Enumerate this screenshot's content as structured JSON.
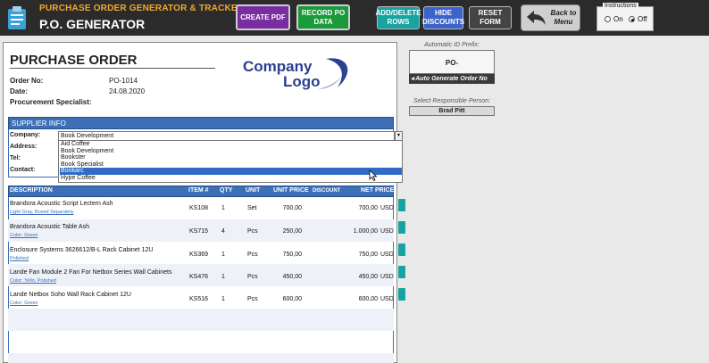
{
  "app": {
    "subtitle": "PURCHASE ORDER GENERATOR & TRACKER",
    "title": "P.O. GENERATOR"
  },
  "toolbar": {
    "create_pdf": "CREATE PDF",
    "record_po": "RECORD PO DATA",
    "add_delete": "ADD/DELETE ROWS",
    "hide_discounts": "HIDE DISCOUNTS",
    "reset_form": "RESET FORM",
    "back_to_menu": "Back to Menu"
  },
  "instructions": {
    "label": "Instructions",
    "on": "On",
    "off": "Off",
    "selected": "Off"
  },
  "po": {
    "title": "PURCHASE ORDER",
    "order_no_label": "Order No:",
    "order_no": "PO-1014",
    "date_label": "Date:",
    "date": "24.08.2020",
    "specialist_label": "Procurement Specialist:"
  },
  "logo": {
    "line1": "Company",
    "line2": "Logo"
  },
  "supplier": {
    "header": "SUPPLIER INFO",
    "company_label": "Company:",
    "company_value": "Book Development",
    "address_label": "Address:",
    "tel_label": "Tel:",
    "contact_label": "Contact:",
    "options": [
      "Aid Coffee",
      "Book Development",
      "Bookster",
      "Book Specialist",
      "Bookarc",
      "Hype Coffee"
    ],
    "selected_option": "Bookarc"
  },
  "table": {
    "headers": {
      "description": "DESCRIPTION",
      "item": "ITEM #",
      "qty": "QTY",
      "unit": "UNIT",
      "unit_price": "UNIT PRICE",
      "discount": "DISCOUNT",
      "net_price": "NET PRICE"
    },
    "rows": [
      {
        "name": "Brandora Acoustic Script Lectern Ash",
        "sub": "Light Gray, Boxed Separately",
        "item": "KS108",
        "qty": "1",
        "unit": "Set",
        "unit_price": "700,00",
        "net_price": "700,00",
        "currency": "USD"
      },
      {
        "name": "Brandora Acoustic Table Ash",
        "sub": "Color: Green",
        "item": "KS715",
        "qty": "4",
        "unit": "Pcs",
        "unit_price": "250,00",
        "net_price": "1.000,00",
        "currency": "USD"
      },
      {
        "name": "Enclosure Systems 3626612/B-L Rack Cabinet 12U",
        "sub": "Polished",
        "item": "KS369",
        "qty": "1",
        "unit": "Pcs",
        "unit_price": "750,00",
        "net_price": "750,00",
        "currency": "USD"
      },
      {
        "name": "Lande Fan Module 2 Fan For Netbox Series Wall Cabinets",
        "sub": "Color: Yello, Polished",
        "item": "KS476",
        "qty": "1",
        "unit": "Pcs",
        "unit_price": "450,00",
        "net_price": "450,00",
        "currency": "USD"
      },
      {
        "name": "Lande Netbox Soho Wall Rack Cabinet 12U",
        "sub": "Color: Green",
        "item": "KS516",
        "qty": "1",
        "unit": "Pcs",
        "unit_price": "600,00",
        "net_price": "600,00",
        "currency": "USD"
      }
    ]
  },
  "side_panel": {
    "auto_id_label": "Automatic ID Prefix:",
    "auto_id_value": "PO-",
    "auto_generate_label": "Auto Generate Order No",
    "responsible_label": "Select Responsible Person:",
    "responsible_value": "Brad Pitt"
  },
  "colors": {
    "header_bg": "#2b2b2b",
    "accent_blue": "#3c6fb6",
    "pdf_purple": "#7a2da0",
    "record_green": "#1a9a3a",
    "teal": "#17a3a0"
  }
}
